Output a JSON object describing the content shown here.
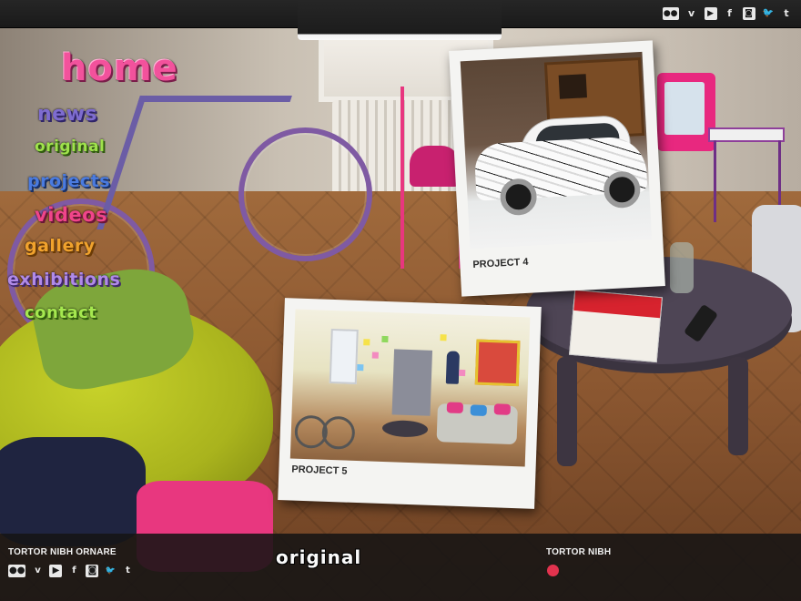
{
  "topbar": {
    "social_icons": [
      {
        "name": "flickr-icon",
        "glyph": "●●"
      },
      {
        "name": "vimeo-icon",
        "glyph": "v"
      },
      {
        "name": "youtube-icon",
        "glyph": "▶"
      },
      {
        "name": "facebook-icon",
        "glyph": "f"
      },
      {
        "name": "instagram-icon",
        "glyph": "◙"
      },
      {
        "name": "twitter-icon",
        "glyph": "🐦"
      },
      {
        "name": "tumblr-icon",
        "glyph": "t"
      }
    ]
  },
  "nav": {
    "home": "home",
    "news": "news",
    "original": "original",
    "projects": "projects",
    "videos": "videos",
    "gallery": "gallery",
    "exhibitions": "exhibitions",
    "contact": "contact"
  },
  "colors": {
    "home": "#f2529c",
    "news": "#7e6cd0",
    "original": "#9fe24c",
    "projects": "#4a7be0",
    "videos": "#f0458a",
    "gallery": "#f0a22d",
    "exhibitions": "#b08ae8",
    "contact": "#a5e84f",
    "footer_dot": "#e2334e"
  },
  "polaroids": [
    {
      "caption": "PROJECT 4"
    },
    {
      "caption": "PROJECT 5"
    }
  ],
  "footer": {
    "left_title": "TORTOR NIBH ORNARE",
    "logo_text": "original",
    "right_title": "TORTOR NIBH"
  }
}
